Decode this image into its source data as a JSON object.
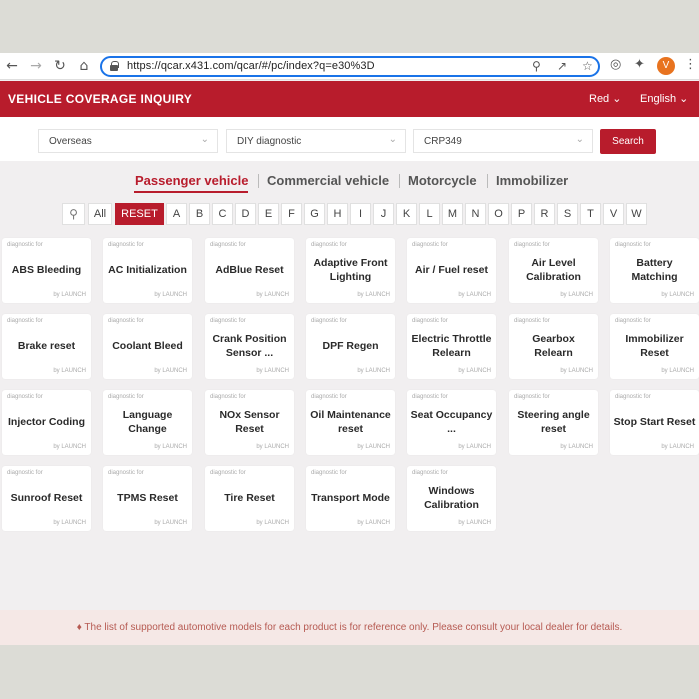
{
  "browser": {
    "url": "https://qcar.x431.com/qcar/#/pc/index?q=e30%3D",
    "avatar_letter": "V"
  },
  "header": {
    "title": "VEHICLE COVERAGE INQUIRY",
    "region": "Red",
    "language": "English",
    "color": "#b81c2c"
  },
  "search": {
    "region_value": "Overseas",
    "type_value": "DIY diagnostic",
    "product_value": "CRP349",
    "button_label": "Search"
  },
  "tabs": [
    {
      "label": "Passenger vehicle",
      "active": true
    },
    {
      "label": "Commercial vehicle",
      "active": false
    },
    {
      "label": "Motorcycle",
      "active": false
    },
    {
      "label": "Immobilizer",
      "active": false
    }
  ],
  "filters": {
    "search_icon": "search-icon",
    "all": "All",
    "reset": "RESET",
    "letters": [
      "A",
      "B",
      "C",
      "D",
      "E",
      "F",
      "G",
      "H",
      "I",
      "J",
      "K",
      "L",
      "M",
      "N",
      "O",
      "P",
      "R",
      "S",
      "T",
      "V",
      "W"
    ]
  },
  "card_caption": "diagnostic for",
  "card_brand": "by LAUNCH",
  "cards": [
    "ABS Bleeding",
    "AC Initialization",
    "AdBlue Reset",
    "Adaptive Front Lighting",
    "Air / Fuel reset",
    "Air Level Calibration",
    "Battery Matching",
    "Brake reset",
    "Coolant Bleed",
    "Crank Position Sensor ...",
    "DPF Regen",
    "Electric Throttle Relearn",
    "Gearbox Relearn",
    "Immobilizer Reset",
    "Injector Coding",
    "Language Change",
    "NOx Sensor Reset",
    "Oil Maintenance reset",
    "Seat Occupancy ...",
    "Steering angle reset",
    "Stop Start Reset",
    "Sunroof Reset",
    "TPMS Reset",
    "Tire Reset",
    "Transport Mode",
    "Windows Calibration"
  ],
  "footer": {
    "icon": "bell-icon",
    "text": "The list of supported automotive models for each product is for reference only. Please consult your local dealer for details."
  }
}
